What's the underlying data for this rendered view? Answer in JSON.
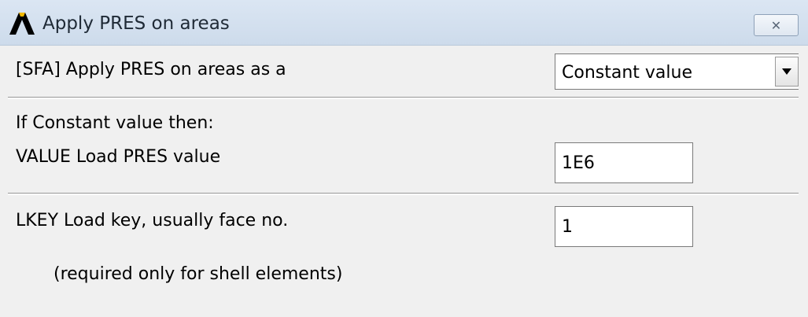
{
  "window": {
    "title": "Apply PRES on areas",
    "close_glyph": "✕"
  },
  "sfa": {
    "label": "[SFA] Apply PRES on areas as a",
    "selected": "Constant value"
  },
  "constant": {
    "heading": "If Constant value then:",
    "value_label": "VALUE  Load PRES value",
    "value": "1E6"
  },
  "lkey": {
    "label": "LKEY  Load key, usually face no.",
    "value": "1",
    "note": "(required only for shell elements)"
  },
  "icons": {
    "app": "ansys-logo-icon",
    "close": "close-icon",
    "dropdown": "chevron-down-icon"
  }
}
